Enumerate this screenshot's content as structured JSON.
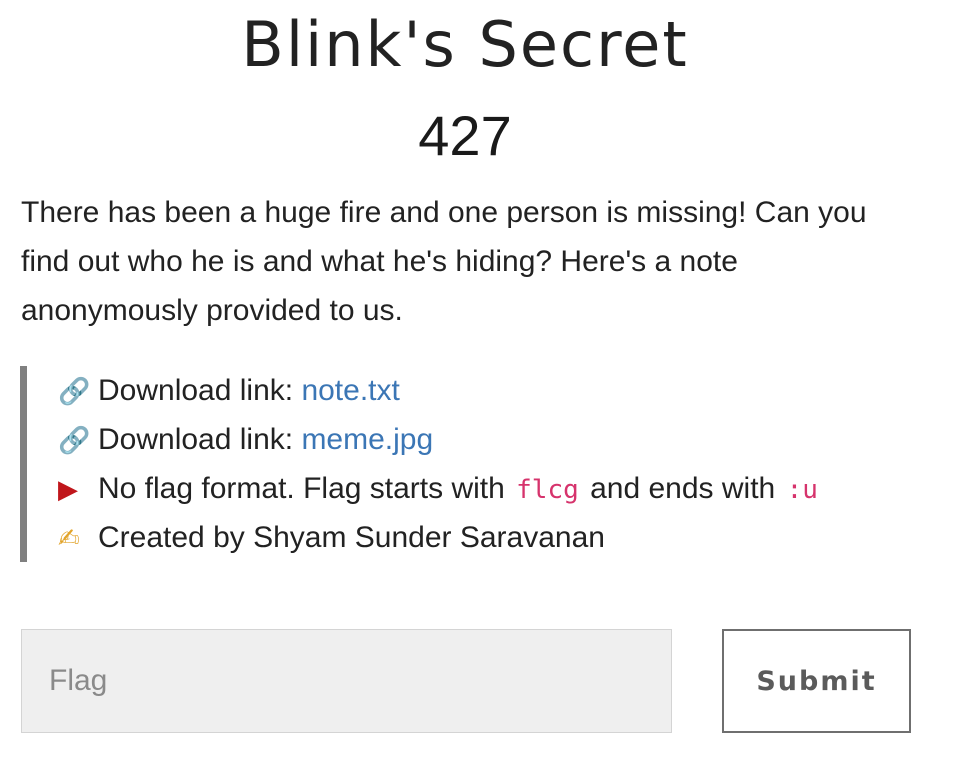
{
  "challenge": {
    "title": "Blink's Secret",
    "points": "427",
    "description": "There has been a huge fire and one person is missing! Can you find out who he is and what he's hiding? Here's a note anonymously provided to us."
  },
  "info": {
    "download1": {
      "icon": "link-icon",
      "label": "Download link: ",
      "link_text": "note.txt"
    },
    "download2": {
      "icon": "link-icon",
      "label": "Download link: ",
      "link_text": "meme.jpg"
    },
    "flag_format": {
      "icon": "red-flag-icon",
      "text_before": "No flag format. Flag starts with ",
      "start_code": "flcg",
      "text_middle": " and ends with ",
      "end_code": ":u"
    },
    "author": {
      "icon": "writing-hand-icon",
      "text": "Created by Shyam Sunder Saravanan"
    }
  },
  "form": {
    "flag_placeholder": "Flag",
    "flag_value": "",
    "submit_label": "Submit"
  },
  "colors": {
    "link": "#3b76b5",
    "code": "#d6336c",
    "quote_border": "#808080"
  }
}
